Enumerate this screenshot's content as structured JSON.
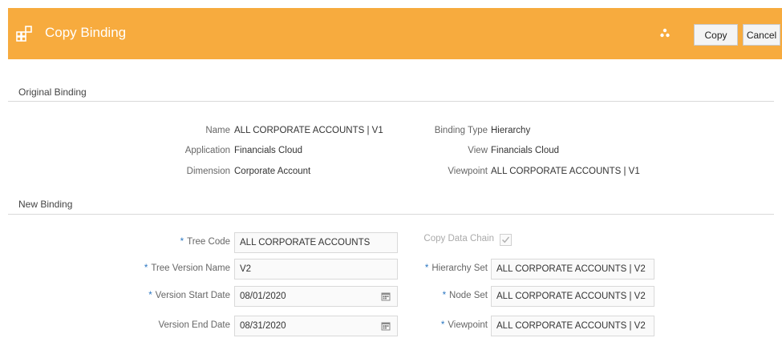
{
  "header": {
    "title": "Copy Binding",
    "copy_label": "Copy",
    "cancel_label": "Cancel",
    "accent": "#f7ab3e"
  },
  "original": {
    "section_title": "Original Binding",
    "name_label": "Name",
    "name_value": "ALL CORPORATE ACCOUNTS | V1",
    "application_label": "Application",
    "application_value": "Financials Cloud",
    "dimension_label": "Dimension",
    "dimension_value": "Corporate Account",
    "binding_type_label": "Binding Type",
    "binding_type_value": "Hierarchy",
    "view_label": "View",
    "view_value": "Financials Cloud",
    "viewpoint_label": "Viewpoint",
    "viewpoint_value": "ALL CORPORATE ACCOUNTS | V1"
  },
  "new_binding": {
    "section_title": "New Binding",
    "required_marker": "*",
    "tree_code_label": "Tree Code",
    "tree_code_value": "ALL CORPORATE ACCOUNTS",
    "tree_version_name_label": "Tree Version Name",
    "tree_version_name_value": "V2",
    "version_start_date_label": "Version Start Date",
    "version_start_date_value": "08/01/2020",
    "version_end_date_label": "Version End Date",
    "version_end_date_value": "08/31/2020",
    "copy_data_chain_label": "Copy Data Chain",
    "copy_data_chain_checked": true,
    "hierarchy_set_label": "Hierarchy Set",
    "hierarchy_set_value": "ALL CORPORATE ACCOUNTS | V2",
    "node_set_label": "Node Set",
    "node_set_value": "ALL CORPORATE ACCOUNTS | V2",
    "viewpoint_label": "Viewpoint",
    "viewpoint_value": "ALL CORPORATE ACCOUNTS | V2"
  }
}
